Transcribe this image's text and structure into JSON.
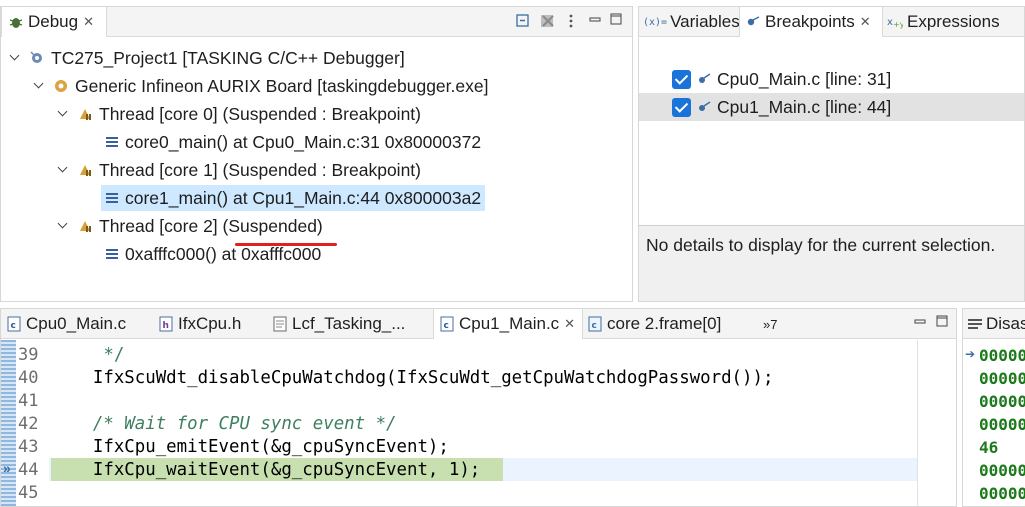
{
  "debug_view": {
    "tab_title": "Debug",
    "tree": {
      "project": "TC275_Project1 [TASKING C/C++ Debugger]",
      "board": "Generic Infineon AURIX Board [taskingdebugger.exe]",
      "thread0": "Thread [core 0] (Suspended : Breakpoint)",
      "frame0": "core0_main() at Cpu0_Main.c:31 0x80000372",
      "thread1": "Thread [core 1] (Suspended : Breakpoint)",
      "frame1": "core1_main() at Cpu1_Main.c:44 0x800003a2",
      "thread2_prefix": "Thread [core 2] ",
      "thread2_state": "(Suspended)",
      "frame2": "0xafffc000() at 0xafffc000"
    }
  },
  "right_view": {
    "tabs": [
      "Variables",
      "Breakpoints",
      "Expressions"
    ],
    "active_tab": "Breakpoints",
    "breakpoints": [
      {
        "file": "Cpu0_Main.c",
        "line": "[line: 31]",
        "checked": true
      },
      {
        "file": "Cpu1_Main.c",
        "line": "[line: 44]",
        "checked": true
      }
    ],
    "details_text": "No details to display for the current selection."
  },
  "editor": {
    "tabs": [
      "Cpu0_Main.c",
      "IfxCpu.h",
      "Lcf_Tasking_...",
      "Cpu1_Main.c",
      "core 2.frame[0]"
    ],
    "active_tab": "Cpu1_Main.c",
    "overflow_count": "»7",
    "lines": [
      {
        "num": "39",
        "text": "     */",
        "comment": true
      },
      {
        "num": "40",
        "text": "    IfxScuWdt_disableCpuWatchdog(IfxScuWdt_getCpuWatchdogPassword());",
        "comment": false
      },
      {
        "num": "41",
        "text": "",
        "comment": false
      },
      {
        "num": "42",
        "text": "    /* Wait for CPU sync event */",
        "comment": true
      },
      {
        "num": "43",
        "text": "    IfxCpu_emitEvent(&g_cpuSyncEvent);",
        "comment": false
      },
      {
        "num": "44",
        "text": "    IfxCpu_waitEvent(&g_cpuSyncEvent, 1);",
        "comment": false
      },
      {
        "num": "45",
        "text": "",
        "comment": false
      }
    ],
    "current_line": "44"
  },
  "disassembly": {
    "tab_title": "Disas",
    "lines": [
      "00000",
      "00000",
      "00000",
      "00000",
      "46",
      "00000",
      "00000"
    ]
  },
  "colors": {
    "selection": "#cde8ff",
    "current_line": "#c8dfb0",
    "accent_blue": "#1a73d8",
    "red_mark": "#e02020"
  }
}
